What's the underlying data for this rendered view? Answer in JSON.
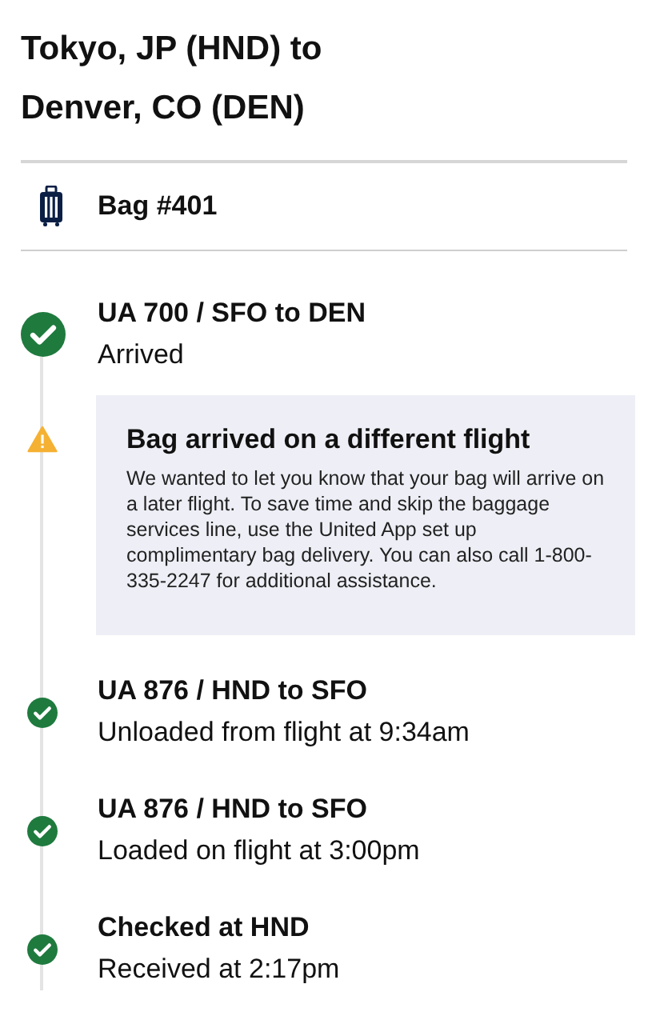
{
  "trip": {
    "title": "Tokyo, JP (HND) to Denver, CO (DEN)"
  },
  "bag": {
    "label": "Bag #401"
  },
  "timeline": [
    {
      "kind": "event",
      "current": true,
      "title": "UA 700 / SFO to DEN",
      "detail": "Arrived"
    },
    {
      "kind": "alert",
      "title": "Bag arrived on a different flight",
      "message": "We wanted to let you know that your bag will arrive on a later flight. To save time and skip the baggage services line, use the United App set up complimentary bag delivery. You can also call 1-800-335-2247 for additional assistance."
    },
    {
      "kind": "event",
      "current": false,
      "title": "UA 876 / HND to SFO",
      "detail": "Unloaded from flight at 9:34am"
    },
    {
      "kind": "event",
      "current": false,
      "title": "UA 876 / HND to SFO",
      "detail": "Loaded on flight at 3:00pm"
    },
    {
      "kind": "event",
      "current": false,
      "title": "Checked at HND",
      "detail": "Received at 2:17pm"
    }
  ]
}
